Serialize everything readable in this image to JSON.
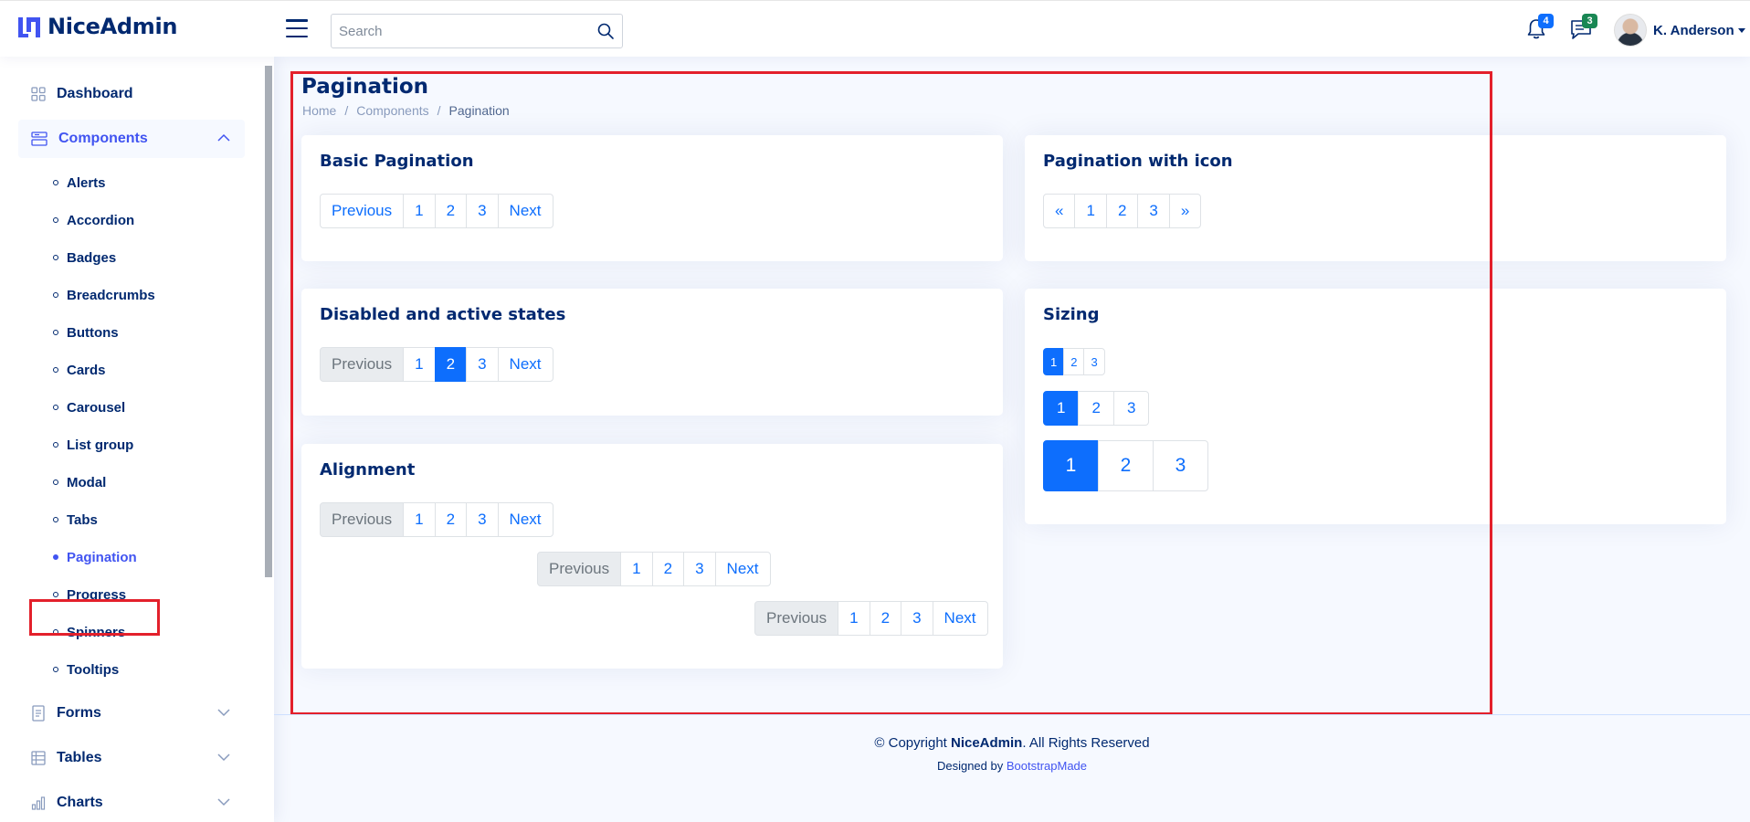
{
  "brand": {
    "name": "NiceAdmin",
    "logo_icon": "niceadmin-logo-icon"
  },
  "header": {
    "search_placeholder": "Search",
    "notifications_count": "4",
    "messages_count": "3",
    "profile_name": "K. Anderson",
    "colors": {
      "notif_badge": "#0d6efd",
      "msg_badge": "#198754"
    }
  },
  "sidebar": {
    "dashboard": "Dashboard",
    "components": "Components",
    "sub_items": [
      "Alerts",
      "Accordion",
      "Badges",
      "Breadcrumbs",
      "Buttons",
      "Cards",
      "Carousel",
      "List group",
      "Modal",
      "Tabs",
      "Pagination",
      "Progress",
      "Spinners",
      "Tooltips"
    ],
    "forms": "Forms",
    "tables": "Tables",
    "charts": "Charts"
  },
  "page": {
    "title": "Pagination",
    "breadcrumb": [
      "Home",
      "Components",
      "Pagination"
    ]
  },
  "cards": {
    "basic": {
      "title": "Basic Pagination",
      "items": [
        "Previous",
        "1",
        "2",
        "3",
        "Next"
      ]
    },
    "icon": {
      "title": "Pagination with icon",
      "items": [
        "«",
        "1",
        "2",
        "3",
        "»"
      ]
    },
    "states": {
      "title": "Disabled and active states",
      "items": [
        "Previous",
        "1",
        "2",
        "3",
        "Next"
      ]
    },
    "sizing": {
      "title": "Sizing",
      "items": [
        "1",
        "2",
        "3"
      ]
    },
    "alignment": {
      "title": "Alignment",
      "items": [
        "Previous",
        "1",
        "2",
        "3",
        "Next"
      ]
    }
  },
  "footer": {
    "copyright_prefix": "© Copyright",
    "copyright_brand": "NiceAdmin",
    "copyright_suffix": ". All Rights Reserved",
    "designed_by": "Designed by",
    "designer": "BootstrapMade"
  }
}
